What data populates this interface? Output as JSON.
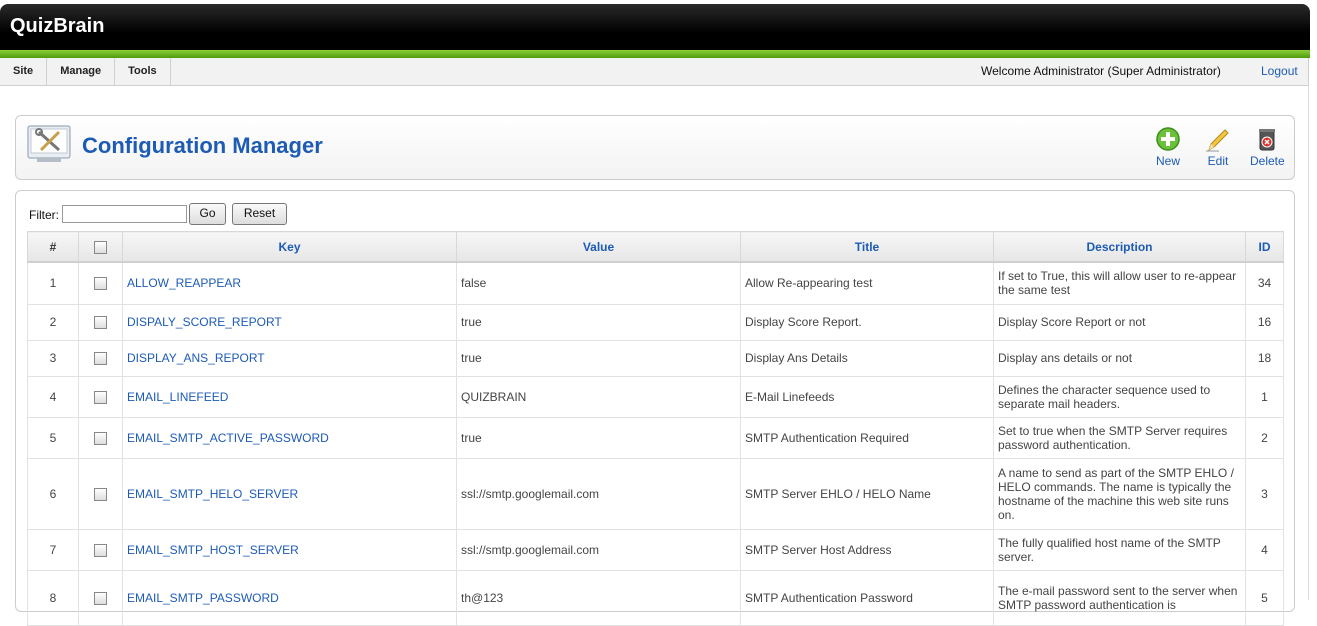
{
  "app": {
    "title": "QuizBrain"
  },
  "menu": [
    "Site",
    "Manage",
    "Tools"
  ],
  "user": {
    "welcome": "Welcome Administrator (Super Administrator)",
    "logout": "Logout"
  },
  "page": {
    "title": "Configuration Manager"
  },
  "toolbar": {
    "new_label": "New",
    "edit_label": "Edit",
    "delete_label": "Delete"
  },
  "filter": {
    "label": "Filter:",
    "value": "",
    "go_label": "Go",
    "reset_label": "Reset"
  },
  "table": {
    "headers": {
      "num": "#",
      "key": "Key",
      "value": "Value",
      "title": "Title",
      "description": "Description",
      "id": "ID"
    },
    "rows": [
      {
        "num": "1",
        "key": "ALLOW_REAPPEAR",
        "value": "false",
        "title": "Allow Re-appearing test",
        "description": "If set to True, this will allow user to re-appear the same test",
        "id": "34"
      },
      {
        "num": "2",
        "key": "DISPALY_SCORE_REPORT",
        "value": "true",
        "title": "Display Score Report.",
        "description": "Display Score Report or not",
        "id": "16"
      },
      {
        "num": "3",
        "key": "DISPLAY_ANS_REPORT",
        "value": "true",
        "title": "Display Ans Details",
        "description": "Display ans details or not",
        "id": "18"
      },
      {
        "num": "4",
        "key": "EMAIL_LINEFEED",
        "value": "QUIZBRAIN",
        "title": "E-Mail Linefeeds",
        "description": "Defines the character sequence used to separate mail headers.",
        "id": "1"
      },
      {
        "num": "5",
        "key": "EMAIL_SMTP_ACTIVE_PASSWORD",
        "value": "true",
        "title": "SMTP Authentication Required",
        "description": "Set to true when the SMTP Server requires password authentication.",
        "id": "2"
      },
      {
        "num": "6",
        "key": "EMAIL_SMTP_HELO_SERVER",
        "value": "ssl://smtp.googlemail.com",
        "title": "SMTP Server EHLO / HELO Name",
        "description": "A name to send as part of the SMTP EHLO / HELO commands. The name is typically the hostname of the machine this web site runs on.",
        "id": "3"
      },
      {
        "num": "7",
        "key": "EMAIL_SMTP_HOST_SERVER",
        "value": "ssl://smtp.googlemail.com",
        "title": "SMTP Server Host Address",
        "description": "The fully qualified host name of the SMTP server.",
        "id": "4"
      },
      {
        "num": "8",
        "key": "EMAIL_SMTP_PASSWORD",
        "value": "th@123",
        "title": "SMTP Authentication Password",
        "description": "The e-mail password sent to the server when SMTP password authentication is",
        "id": "5"
      }
    ]
  }
}
